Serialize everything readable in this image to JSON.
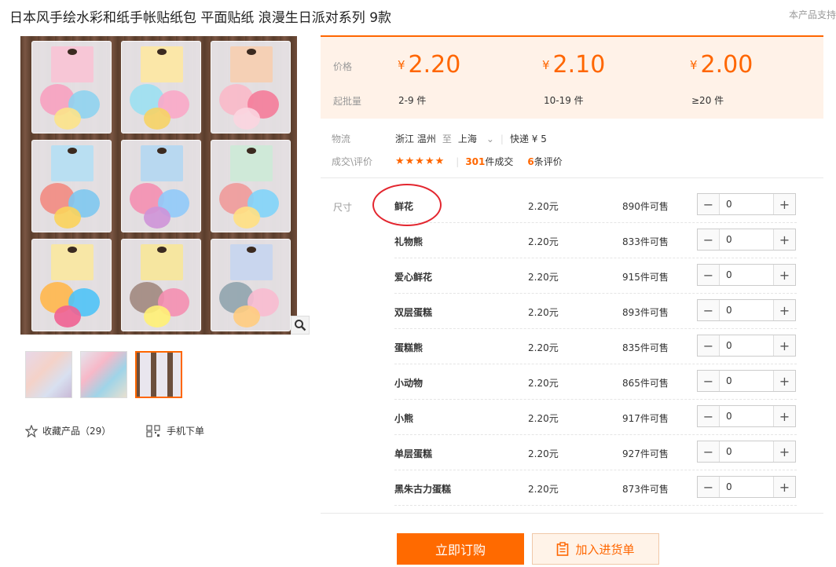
{
  "product": {
    "title": "日本风手绘水彩和纸手帐贴纸包 平面贴纸 浪漫生日派对系列 9款",
    "support_text": "本产品支持"
  },
  "gallery": {
    "favorite_label": "收藏产品（29）",
    "mobile_label": "手机下单"
  },
  "pricing": {
    "price_label": "价格",
    "min_qty_label": "起批量",
    "currency": "¥",
    "tiers": [
      {
        "price": "2.20",
        "qty": "2-9 件"
      },
      {
        "price": "2.10",
        "qty": "10-19 件"
      },
      {
        "price": "2.00",
        "qty": "≥20 件"
      }
    ]
  },
  "logistics": {
    "label": "物流",
    "from": "浙江 温州",
    "to_word": "至",
    "to": "上海",
    "shipping": "快递 ¥ 5"
  },
  "deals": {
    "label": "成交\\评价",
    "stars": "★★★★★",
    "deal_count": "301",
    "deal_suffix": "件成交",
    "review_count": "6",
    "review_suffix": "条评价"
  },
  "sku": {
    "label": "尺寸",
    "rows": [
      {
        "name": "鲜花",
        "price": "2.20元",
        "stock": "890件可售",
        "qty": "0"
      },
      {
        "name": "礼物熊",
        "price": "2.20元",
        "stock": "833件可售",
        "qty": "0"
      },
      {
        "name": "爱心鲜花",
        "price": "2.20元",
        "stock": "915件可售",
        "qty": "0"
      },
      {
        "name": "双层蛋糕",
        "price": "2.20元",
        "stock": "893件可售",
        "qty": "0"
      },
      {
        "name": "蛋糕熊",
        "price": "2.20元",
        "stock": "835件可售",
        "qty": "0"
      },
      {
        "name": "小动物",
        "price": "2.20元",
        "stock": "865件可售",
        "qty": "0"
      },
      {
        "name": "小熊",
        "price": "2.20元",
        "stock": "917件可售",
        "qty": "0"
      },
      {
        "name": "单层蛋糕",
        "price": "2.20元",
        "stock": "927件可售",
        "qty": "0"
      },
      {
        "name": "黑朱古力蛋糕",
        "price": "2.20元",
        "stock": "873件可售",
        "qty": "0"
      }
    ]
  },
  "actions": {
    "buy_label": "立即订购",
    "cart_label": "加入进货单"
  },
  "colors": {
    "accent": "#ff6a00",
    "annotation": "#e3262f"
  }
}
